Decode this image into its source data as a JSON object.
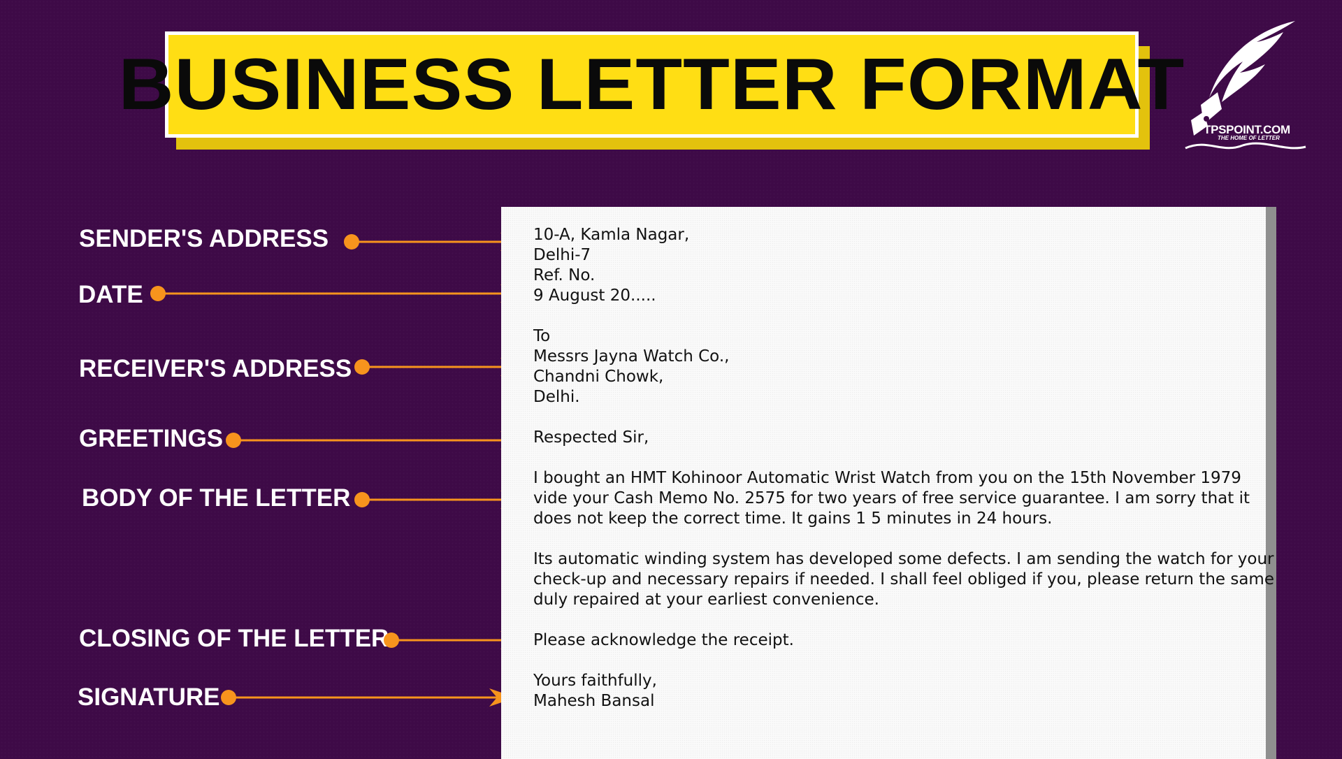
{
  "title": "BUSINESS LETTER FORMAT",
  "logo": {
    "name": "TPSPOINT.COM",
    "tagline": "THE HOME OF LETTER",
    "icon": "quill-pen-icon"
  },
  "colors": {
    "background": "#3e0a47",
    "banner": "#ffde14",
    "arrow": "#f7941d",
    "label_text": "#ffffff"
  },
  "labels": [
    "SENDER'S ADDRESS",
    "DATE",
    "RECEIVER'S ADDRESS",
    "GREETINGS",
    "BODY OF THE LETTER",
    "CLOSING OF THE LETTER",
    "SIGNATURE"
  ],
  "letter": {
    "sender_address": [
      "10-A, Kamla Nagar,",
      "Delhi-7",
      "Ref. No."
    ],
    "date": "9 August 20.....",
    "receiver_address": [
      "To",
      "Messrs Jayna Watch Co.,",
      "Chandni Chowk,",
      "Delhi."
    ],
    "greeting": "Respected Sir,",
    "body_paragraph_1": [
      "I bought an HMT Kohinoor Automatic Wrist Watch from you on the 15th November 1979",
      "vide your Cash Memo No. 2575 for two years of free service guarantee. I am sorry that it",
      "does not keep the correct time. It gains 1 5 minutes in 24 hours."
    ],
    "body_paragraph_2": [
      "Its automatic winding system has developed some defects. I am sending the watch for your",
      "check-up and necessary repairs if needed. I shall feel obliged if you, please return the same",
      "duly repaired at your earliest convenience."
    ],
    "closing": "Please acknowledge the receipt.",
    "signature": [
      "Yours faithfully,",
      "Mahesh Bansal"
    ]
  }
}
